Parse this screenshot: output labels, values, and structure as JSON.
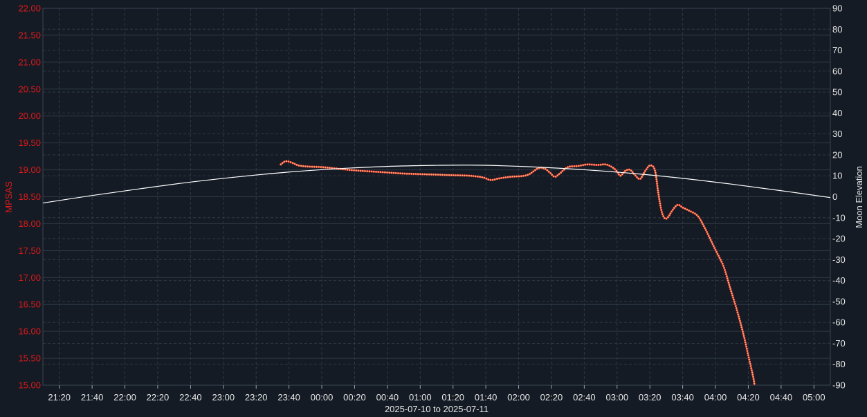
{
  "chart_data": {
    "type": "line",
    "title": "",
    "xlabel": "2025-07-10 to 2025-07-11",
    "ylabel_left": "MPSAS",
    "ylabel_right": "Moon Elevation",
    "x_range": [
      "21:10",
      "05:10"
    ],
    "x_tick_labels": [
      "21:20",
      "21:40",
      "22:00",
      "22:20",
      "22:40",
      "23:00",
      "23:20",
      "23:40",
      "00:00",
      "00:20",
      "00:40",
      "01:00",
      "01:20",
      "01:40",
      "02:00",
      "02:20",
      "02:40",
      "03:00",
      "03:20",
      "03:40",
      "04:00",
      "04:20",
      "04:40",
      "05:00"
    ],
    "y_left_range": [
      15.0,
      22.0
    ],
    "y_left_ticks": [
      "15.00",
      "15.50",
      "16.00",
      "16.50",
      "17.00",
      "17.50",
      "18.00",
      "18.50",
      "19.00",
      "19.50",
      "20.00",
      "20.50",
      "21.00",
      "21.50",
      "22.00"
    ],
    "y_right_range": [
      -90,
      90
    ],
    "y_right_ticks": [
      "-90",
      "-80",
      "-70",
      "-60",
      "-50",
      "-40",
      "-30",
      "-20",
      "-10",
      "0",
      "10",
      "20",
      "30",
      "40",
      "50",
      "60",
      "70",
      "80",
      "90"
    ],
    "grid": true,
    "colors": {
      "background": "#141b24",
      "grid": "#2e3a46",
      "mpsas": "#e01a1a",
      "mpsas_marker": "#f0a878",
      "moon": "#ffffff",
      "left_axis_text": "#e01a1a",
      "right_axis_text": "#e6e6e6"
    },
    "series": [
      {
        "axis": "left",
        "points": [
          [
            "23:35",
            19.1
          ],
          [
            "23:38",
            19.16
          ],
          [
            "23:42",
            19.13
          ],
          [
            "23:46",
            19.08
          ],
          [
            "23:52",
            19.06
          ],
          [
            "00:00",
            19.05
          ],
          [
            "00:10",
            19.02
          ],
          [
            "00:20",
            18.99
          ],
          [
            "00:30",
            18.97
          ],
          [
            "00:40",
            18.95
          ],
          [
            "00:50",
            18.93
          ],
          [
            "01:00",
            18.92
          ],
          [
            "01:10",
            18.91
          ],
          [
            "01:20",
            18.9
          ],
          [
            "01:30",
            18.89
          ],
          [
            "01:38",
            18.86
          ],
          [
            "01:43",
            18.81
          ],
          [
            "01:48",
            18.84
          ],
          [
            "01:55",
            18.87
          ],
          [
            "02:05",
            18.9
          ],
          [
            "02:12",
            19.03
          ],
          [
            "02:16",
            19.02
          ],
          [
            "02:19",
            18.95
          ],
          [
            "02:22",
            18.87
          ],
          [
            "02:25",
            18.93
          ],
          [
            "02:30",
            19.05
          ],
          [
            "02:36",
            19.07
          ],
          [
            "02:42",
            19.1
          ],
          [
            "02:48",
            19.09
          ],
          [
            "02:53",
            19.1
          ],
          [
            "02:57",
            19.05
          ],
          [
            "03:00",
            18.97
          ],
          [
            "03:02",
            18.89
          ],
          [
            "03:05",
            18.98
          ],
          [
            "03:08",
            19.0
          ],
          [
            "03:11",
            18.9
          ],
          [
            "03:14",
            18.83
          ],
          [
            "03:17",
            18.97
          ],
          [
            "03:20",
            19.08
          ],
          [
            "03:23",
            19.0
          ],
          [
            "03:25",
            18.6
          ],
          [
            "03:27",
            18.25
          ],
          [
            "03:29",
            18.1
          ],
          [
            "03:31",
            18.12
          ],
          [
            "03:34",
            18.26
          ],
          [
            "03:37",
            18.35
          ],
          [
            "03:40",
            18.3
          ],
          [
            "03:44",
            18.24
          ],
          [
            "03:49",
            18.15
          ],
          [
            "03:53",
            17.95
          ],
          [
            "03:57",
            17.7
          ],
          [
            "04:01",
            17.45
          ],
          [
            "04:05",
            17.2
          ],
          [
            "04:09",
            16.8
          ],
          [
            "04:13",
            16.4
          ],
          [
            "04:17",
            15.95
          ],
          [
            "04:20",
            15.55
          ],
          [
            "04:23",
            15.15
          ],
          [
            "04:24",
            14.95
          ]
        ]
      },
      {
        "axis": "right",
        "points": [
          [
            "21:10",
            -3
          ],
          [
            "21:40",
            0.6
          ],
          [
            "22:10",
            3.9
          ],
          [
            "22:40",
            7
          ],
          [
            "23:10",
            9.6
          ],
          [
            "23:40",
            11.8
          ],
          [
            "00:10",
            13.4
          ],
          [
            "00:40",
            14.5
          ],
          [
            "01:10",
            15
          ],
          [
            "01:30",
            15.1
          ],
          [
            "01:50",
            14.8
          ],
          [
            "02:10",
            14.2
          ],
          [
            "02:40",
            12.9
          ],
          [
            "03:10",
            11.1
          ],
          [
            "03:40",
            8.8
          ],
          [
            "04:10",
            6
          ],
          [
            "04:40",
            2.9
          ],
          [
            "05:10",
            -0.4
          ]
        ]
      }
    ]
  }
}
